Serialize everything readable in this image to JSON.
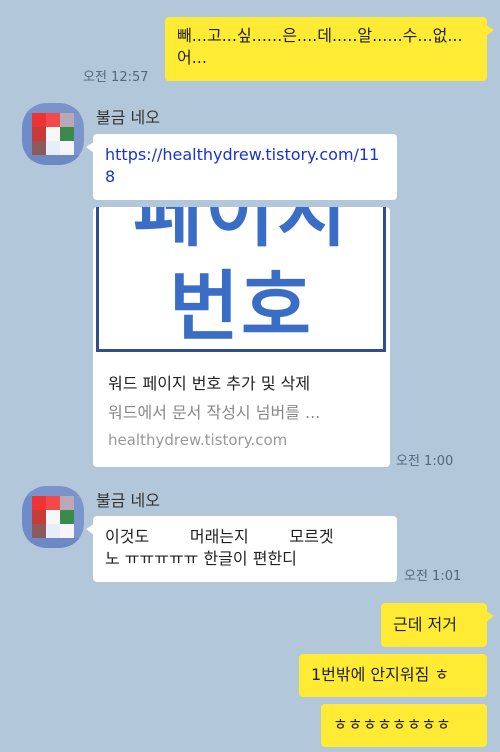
{
  "colors": {
    "background": "#b2c7da",
    "my_bubble": "#ffeb33",
    "other_bubble": "#ffffff",
    "link": "#1a33cc",
    "preview_accent": "#3a6ec6"
  },
  "messages": [
    {
      "direction": "outgoing",
      "text": "빼...고...싶......은....데.....알......수...없...어...",
      "time": "오전 12:57"
    },
    {
      "direction": "incoming",
      "sender": "불금 네오",
      "link": "https://healthydrew.tistory.com/118",
      "preview": {
        "image_line1": "페이지",
        "image_line2": "번호",
        "title": "워드 페이지 번호 추가 및 삭제",
        "description": "워드에서 문서 작성시 넘버를 ...",
        "domain": "healthydrew.tistory.com"
      },
      "time": "오전 1:00"
    },
    {
      "direction": "incoming",
      "sender": "불금 네오",
      "text_line1": "이것도        머래는지        모르겟",
      "text_line2": "노 ㅠㅠㅠㅠㅠ 한글이 편한디",
      "time": "오전 1:01"
    },
    {
      "direction": "outgoing",
      "text": "근데 저거"
    },
    {
      "direction": "outgoing",
      "text": "1번밖에 안지워짐 ㅎ"
    },
    {
      "direction": "outgoing",
      "text": "ㅎㅎㅎㅎㅎㅎㅎㅎ"
    }
  ]
}
